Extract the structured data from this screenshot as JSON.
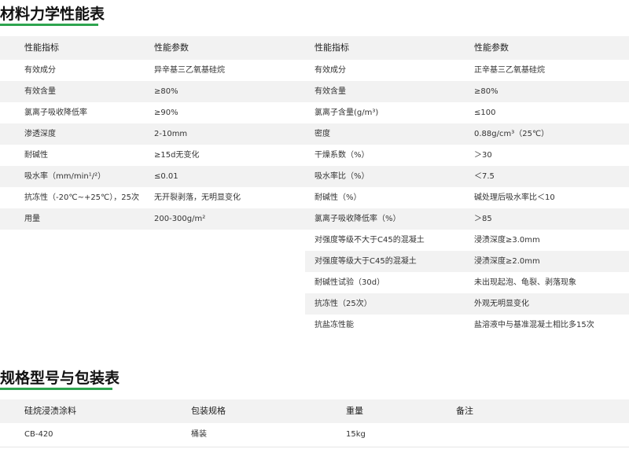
{
  "section1": {
    "title": "材料力学性能表"
  },
  "perf": {
    "headers": [
      "性能指标",
      "性能参数",
      "性能指标",
      "性能参数"
    ],
    "rows": [
      [
        "有效成分",
        "异辛基三乙氧基硅烷",
        "有效成分",
        "正辛基三乙氧基硅烷"
      ],
      [
        "有效含量",
        "≥80%",
        "有效含量",
        "≥80%"
      ],
      [
        "氯离子吸收降低率",
        "≥90%",
        "氯离子含量(g/m³)",
        "≤100"
      ],
      [
        "渗透深度",
        "2-10mm",
        "密度",
        "0.88g/cm³（25℃）"
      ],
      [
        "耐碱性",
        "≥15d无变化",
        "干燥系数（%）",
        "＞30"
      ],
      [
        "吸水率（mm/min¹/²）",
        "≤0.01",
        "吸水率比（%）",
        "＜7.5"
      ],
      [
        "抗冻性（-20℃~+25℃），25次",
        "无开裂剥落，无明显变化",
        "耐碱性（%）",
        "碱处理后吸水率比＜10"
      ],
      [
        "用量",
        "200-300g/m²",
        "氯离子吸收降低率（%）",
        "＞85"
      ],
      [
        "",
        "",
        "对强度等级不大于C45的混凝土",
        "浸渍深度≥3.0mm"
      ],
      [
        "",
        "",
        "对强度等级大于C45的混凝土",
        "浸渍深度≥2.0mm"
      ],
      [
        "",
        "",
        "耐碱性试验（30d）",
        "未出现起泡、龟裂、剥落现象"
      ],
      [
        "",
        "",
        "抗冻性（25次）",
        "外观无明显变化"
      ],
      [
        "",
        "",
        "抗盐冻性能",
        "盐溶液中与基准混凝土相比多15次"
      ]
    ]
  },
  "section2": {
    "title": "规格型号与包装表"
  },
  "spec": {
    "headers": [
      "硅烷浸渍涂料",
      "包装规格",
      "重量",
      "备注"
    ],
    "rows": [
      [
        "CB-420",
        "桶装",
        "15kg",
        ""
      ]
    ]
  }
}
